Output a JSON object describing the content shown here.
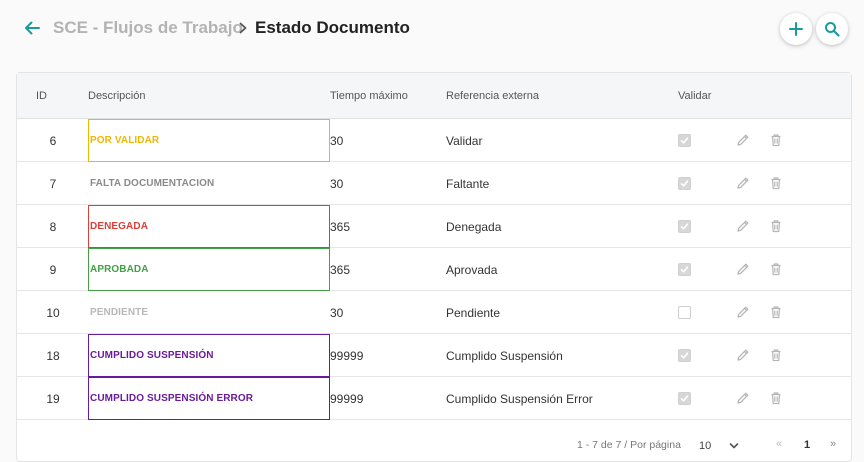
{
  "breadcrumb": {
    "parent": "SCE - Flujos de Trabajo",
    "current": "Estado Documento"
  },
  "colors": {
    "accent": "#1a9aa0",
    "pending": "#f2b705",
    "missing": "#8a8a8a",
    "denied": "#d9403a",
    "approved": "#43a047",
    "pendiente": "#b8b8b8",
    "fulfilled": "#6a1b9a"
  },
  "table": {
    "headers": {
      "id": "ID",
      "description": "Descripción",
      "max_time": "Tiempo máximo",
      "external_ref": "Referencia externa",
      "validate": "Validar"
    },
    "rows": [
      {
        "id": "6",
        "description": "POR VALIDAR",
        "color": "#f2b705",
        "bordered": true,
        "max_time": "30",
        "external_ref": "Validar",
        "validate": true
      },
      {
        "id": "7",
        "description": "FALTA DOCUMENTACION",
        "color": "#8a8a8a",
        "bordered": false,
        "max_time": "30",
        "external_ref": "Faltante",
        "validate": true
      },
      {
        "id": "8",
        "description": "DENEGADA",
        "color": "#d9403a",
        "bordered": true,
        "max_time": "365",
        "external_ref": "Denegada",
        "validate": true
      },
      {
        "id": "9",
        "description": "APROBADA",
        "color": "#43a047",
        "bordered": true,
        "max_time": "365",
        "external_ref": "Aprovada",
        "validate": true
      },
      {
        "id": "10",
        "description": "PENDIENTE",
        "color": "#b8b8b8",
        "bordered": false,
        "max_time": "30",
        "external_ref": "Pendiente",
        "validate": false
      },
      {
        "id": "18",
        "description": "CUMPLIDO SUSPENSIÓN",
        "color": "#6a1b9a",
        "bordered": true,
        "max_time": "99999",
        "external_ref": "Cumplido Suspensión",
        "validate": true
      },
      {
        "id": "19",
        "description": "CUMPLIDO SUSPENSIÓN ERROR",
        "color": "#6a1b9a",
        "bordered": true,
        "max_time": "99999",
        "external_ref": "Cumplido Suspensión Error",
        "validate": true
      }
    ]
  },
  "pagination": {
    "range_text": "1 - 7 de 7 / Por página",
    "page_size": "10",
    "prev": "«",
    "current_page": "1",
    "next": "»"
  },
  "icons": {
    "back": "arrow-left-icon",
    "separator": "chevron-right-icon",
    "add": "plus-icon",
    "search": "search-icon",
    "edit": "pencil-icon",
    "delete": "trash-icon",
    "page_size": "chevron-down-icon"
  }
}
